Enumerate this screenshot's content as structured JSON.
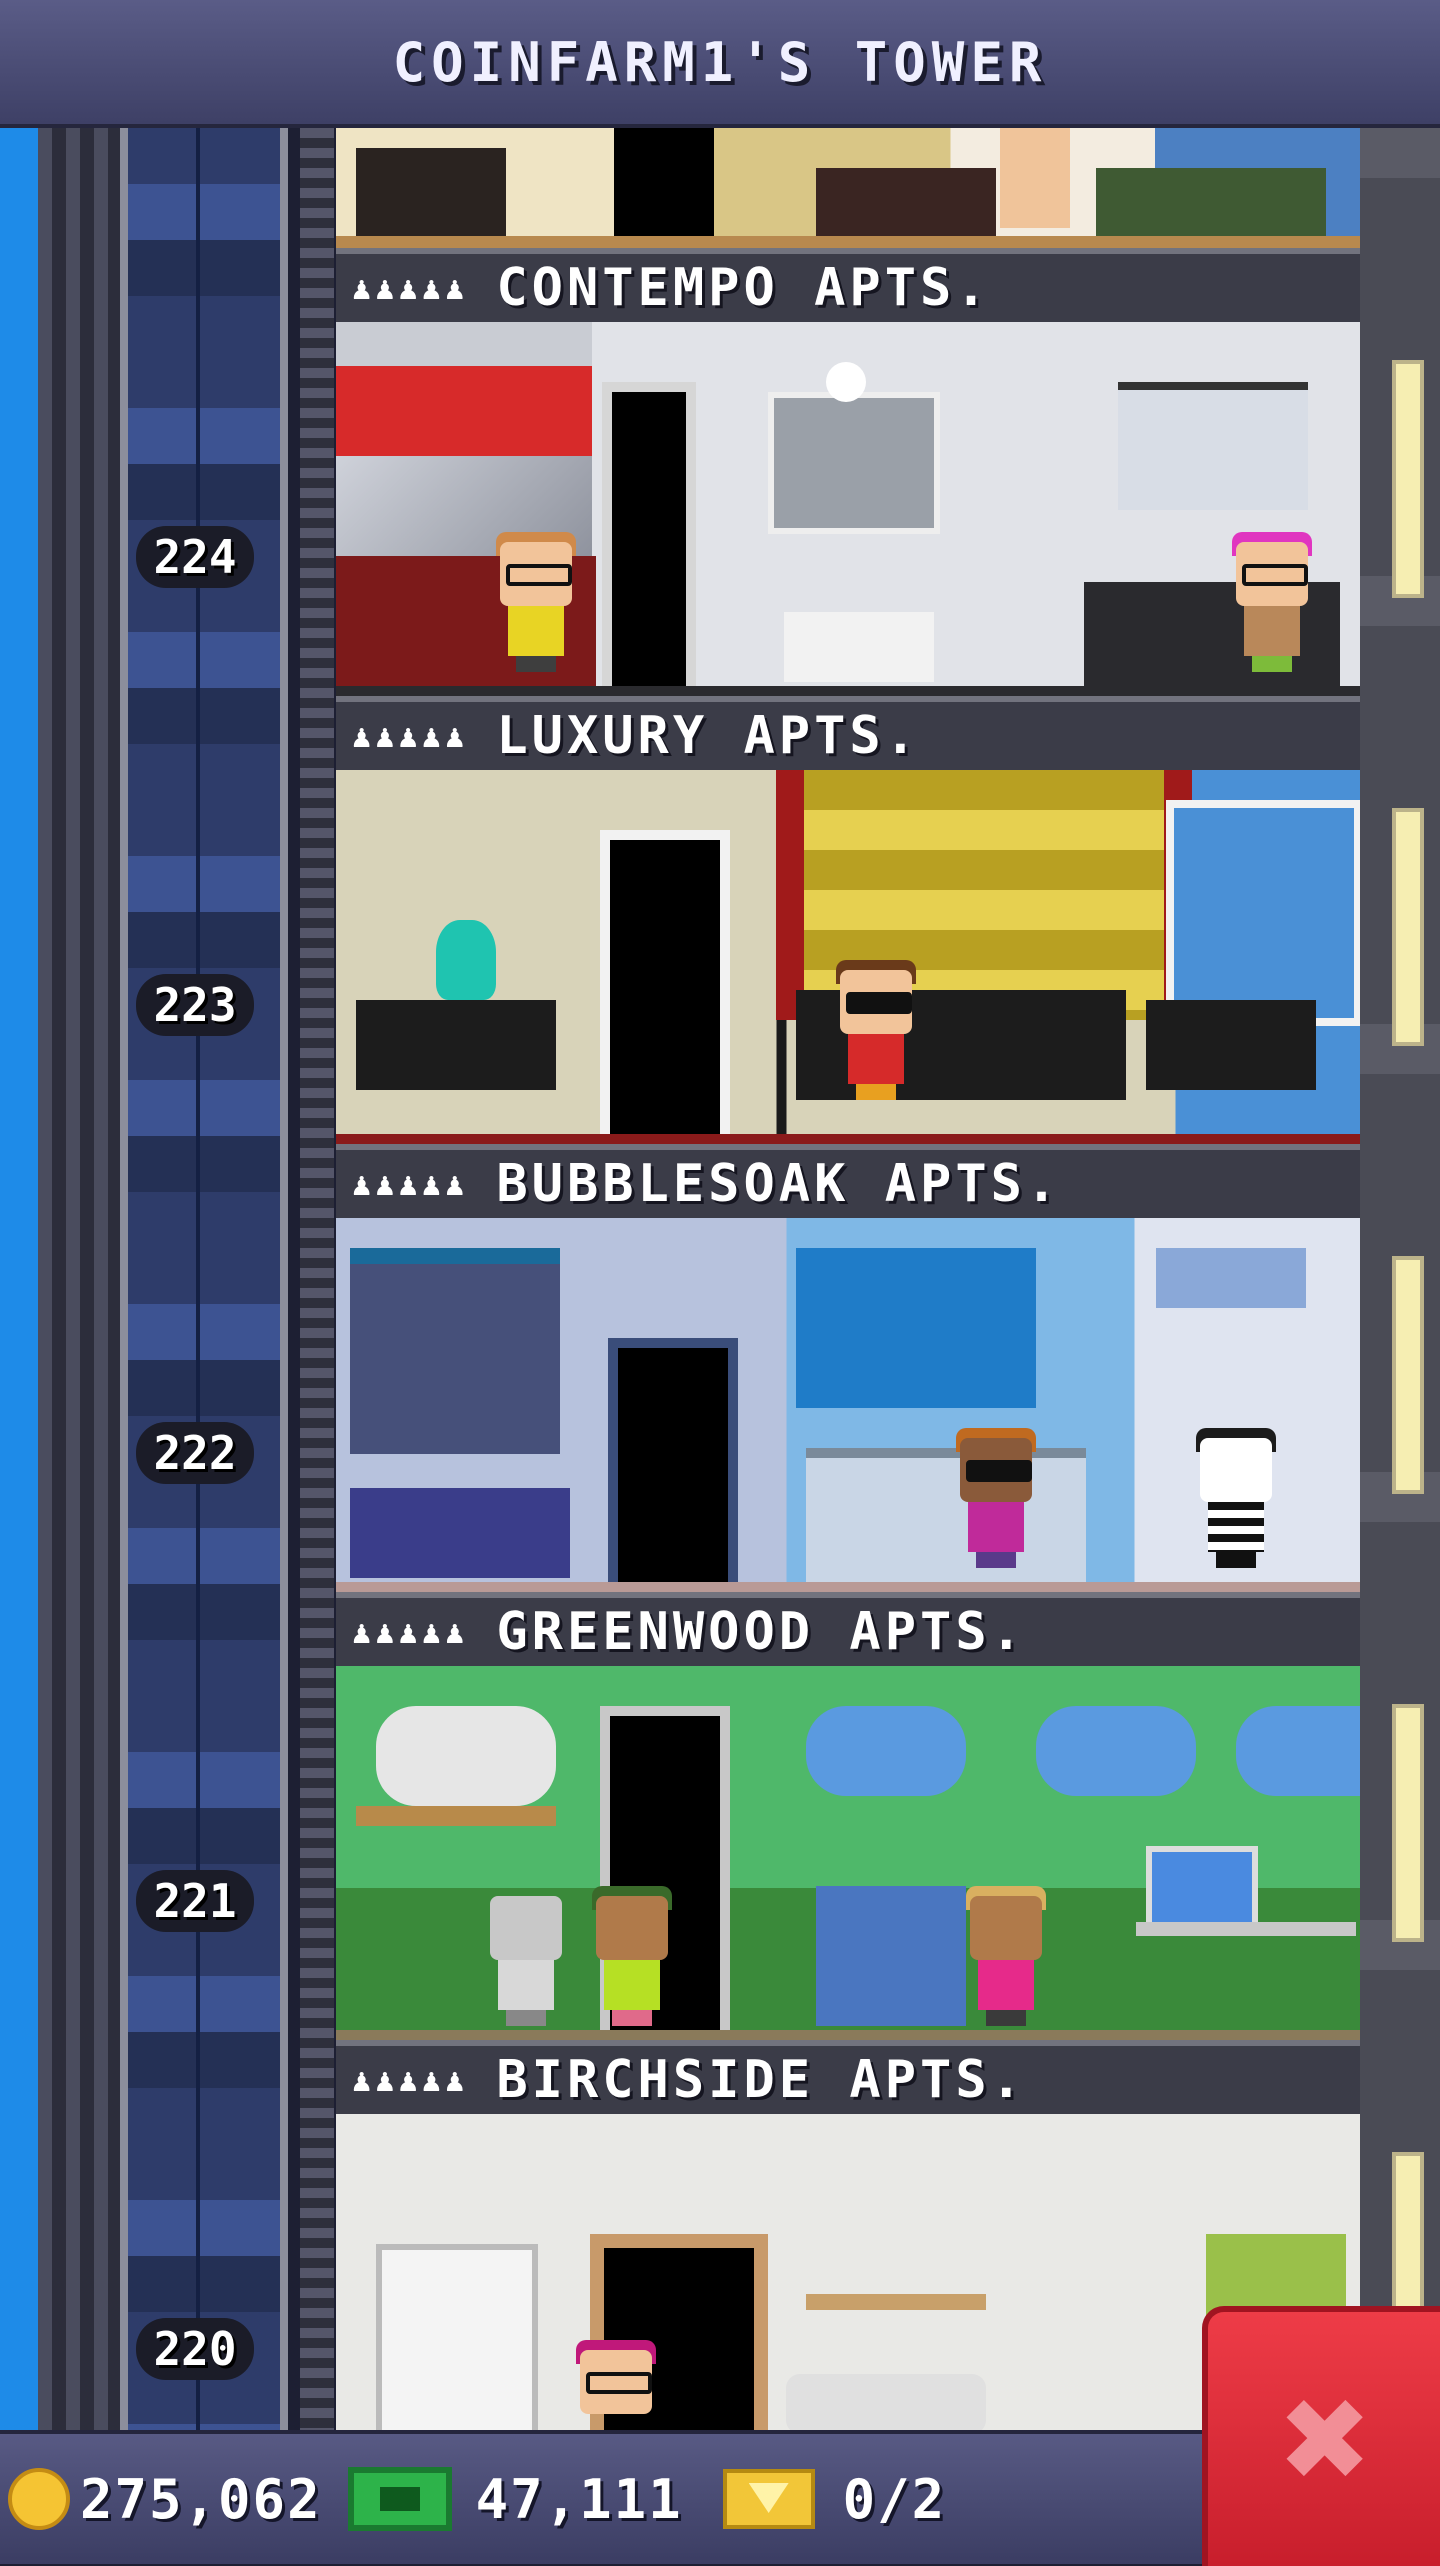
{
  "title": "COINFARM1'S TOWER",
  "floors": [
    {
      "number": "224",
      "name": "CONTEMPO APTS.",
      "residents_icon": "♟♟♟♟♟"
    },
    {
      "number": "223",
      "name": "LUXURY APTS.",
      "residents_icon": "♟♟♟♟♟"
    },
    {
      "number": "222",
      "name": "BUBBLESOAK APTS.",
      "residents_icon": "♟♟♟♟♟"
    },
    {
      "number": "221",
      "name": "GREENWOOD APTS.",
      "residents_icon": "♟♟♟♟♟"
    },
    {
      "number": "220",
      "name": "BIRCHSIDE APTS.",
      "residents_icon": "♟♟♟♟♟"
    }
  ],
  "hud": {
    "coins": "275,062",
    "bux": "47,111",
    "tickets": "0/2"
  },
  "icons": {
    "coin": "coin-icon",
    "bux": "tower-bux-icon",
    "ticket": "golden-ticket-icon",
    "close": "close-icon"
  },
  "close_glyph": "✖",
  "colors": {
    "titlebar": "#4a4c75",
    "sky": "#1e8be8",
    "close_button": "#e02e3a"
  }
}
